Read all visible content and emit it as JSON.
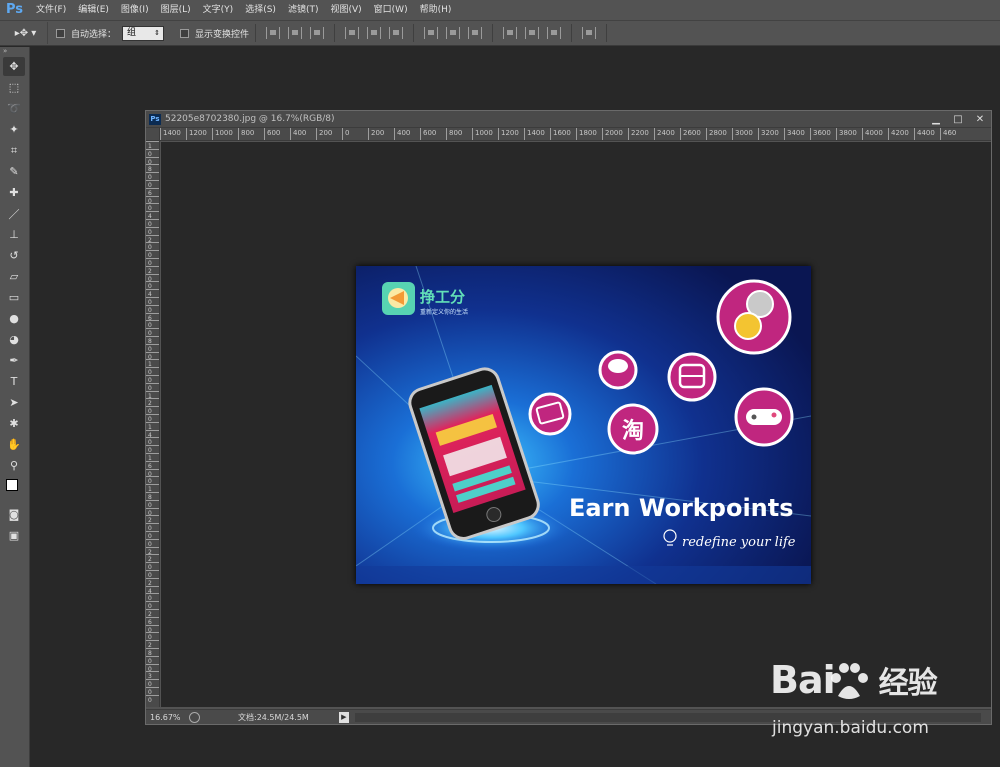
{
  "app": {
    "logo": "Ps"
  },
  "menu": [
    "文件(F)",
    "编辑(E)",
    "图像(I)",
    "图层(L)",
    "文字(Y)",
    "选择(S)",
    "滤镜(T)",
    "视图(V)",
    "窗口(W)",
    "帮助(H)"
  ],
  "options": {
    "auto_select_label": "自动选择：",
    "auto_select_value": "组",
    "show_transform_label": "显示变换控件"
  },
  "document": {
    "title": "52205e8702380.jpg @ 16.7%(RGB/8)",
    "ps_badge": "Ps",
    "zoom": "16.67%",
    "doc_size": "文档:24.5M/24.5M",
    "status_arrow": "▶",
    "win_buttons": [
      "▁",
      "□",
      "✕"
    ],
    "hruler_labels": [
      "1400",
      "1200",
      "1000",
      "800",
      "600",
      "400",
      "200",
      "0",
      "200",
      "400",
      "600",
      "800",
      "1000",
      "1200",
      "1400",
      "1600",
      "1800",
      "2000",
      "2200",
      "2400",
      "2600",
      "2800",
      "3000",
      "3200",
      "3400",
      "3600",
      "3800",
      "4000",
      "4200",
      "4400",
      "460"
    ],
    "vruler_labels": [
      "1",
      "0",
      "0",
      "8",
      "0",
      "0",
      "6",
      "0",
      "0",
      "4",
      "0",
      "0",
      "2",
      "0",
      "0",
      "0",
      "2",
      "0",
      "0",
      "4",
      "0",
      "0",
      "6",
      "0",
      "0",
      "8",
      "0",
      "0",
      "1",
      "0",
      "0",
      "0",
      "1",
      "2",
      "0",
      "0",
      "1",
      "4",
      "0",
      "0",
      "1",
      "6",
      "0",
      "0",
      "1",
      "8",
      "0",
      "0",
      "2",
      "0",
      "0",
      "0",
      "2",
      "2",
      "0",
      "0",
      "2",
      "4",
      "0",
      "0",
      "2",
      "6",
      "0",
      "0",
      "2",
      "8",
      "0",
      "0",
      "3",
      "0",
      "0",
      "0"
    ]
  },
  "artwork": {
    "brand_name": "挣工分",
    "brand_tagline": "重新定义你的生活",
    "headline": "Earn Workpoints",
    "subline": "redefine your life",
    "taobao_glyph": "淘",
    "colors": {
      "bg_dark": "#0a1a5c",
      "bg_glow": "#2aa8f5",
      "circle_magenta": "#c0267f",
      "phone_screen": "#d81e5b"
    }
  },
  "watermark": {
    "brand": "Bai",
    "brand_cn": "经验",
    "url": "jingyan.baidu.com"
  }
}
